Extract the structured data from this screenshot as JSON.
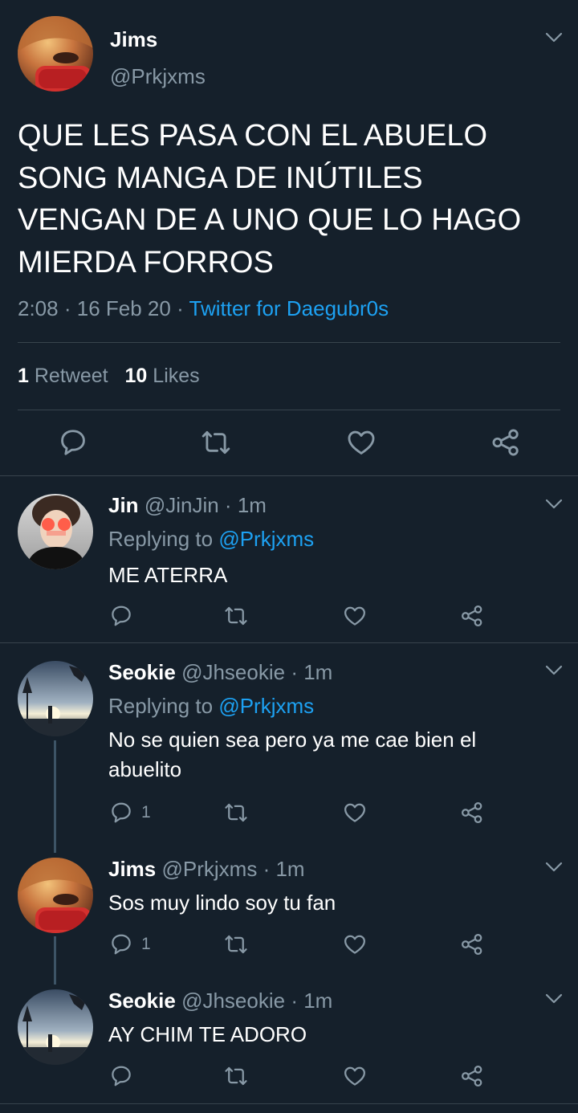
{
  "main_tweet": {
    "author_name": "Jims",
    "handle": "@Prkjxms",
    "text_lines": [
      "QUE LES PASA CON EL ABUELO",
      "SONG MANGA DE INÚTILES",
      "VENGAN DE A UNO QUE LO HAGO",
      "MIERDA FORROS"
    ],
    "time": "2:08",
    "date": "16 Feb 20",
    "source": "Twitter for Daegubr0s",
    "retweet_count": "1",
    "retweet_label": "Retweet",
    "like_count": "10",
    "like_label": "Likes"
  },
  "replies": [
    {
      "name": "Jin",
      "handle": "@JinJin",
      "time": "1m",
      "replying_label": "Replying to",
      "replying_to": "@Prkjxms",
      "text_lines": [
        "ME ATERRA"
      ],
      "reply_count": ""
    },
    {
      "name": "Seokie",
      "handle": "@Jhseokie",
      "time": "1m",
      "replying_label": "Replying to",
      "replying_to": "@Prkjxms",
      "text_lines": [
        "No se quien sea pero ya me cae bien el",
        "abuelito"
      ],
      "reply_count": "1"
    },
    {
      "name": "Jims",
      "handle": "@Prkjxms",
      "time": "1m",
      "text_lines": [
        "Sos muy lindo soy tu fan"
      ],
      "reply_count": "1"
    },
    {
      "name": "Seokie",
      "handle": "@Jhseokie",
      "time": "1m",
      "text_lines": [
        "AY CHIM TE ADORO"
      ],
      "reply_count": ""
    }
  ],
  "separator": "·",
  "colors": {
    "background": "#15202b",
    "text": "#ffffff",
    "muted": "#8899a6",
    "link": "#1da1f2",
    "divider": "#38444d"
  },
  "icons": [
    "chevron-down-icon",
    "reply-icon",
    "retweet-icon",
    "like-icon",
    "share-icon"
  ]
}
